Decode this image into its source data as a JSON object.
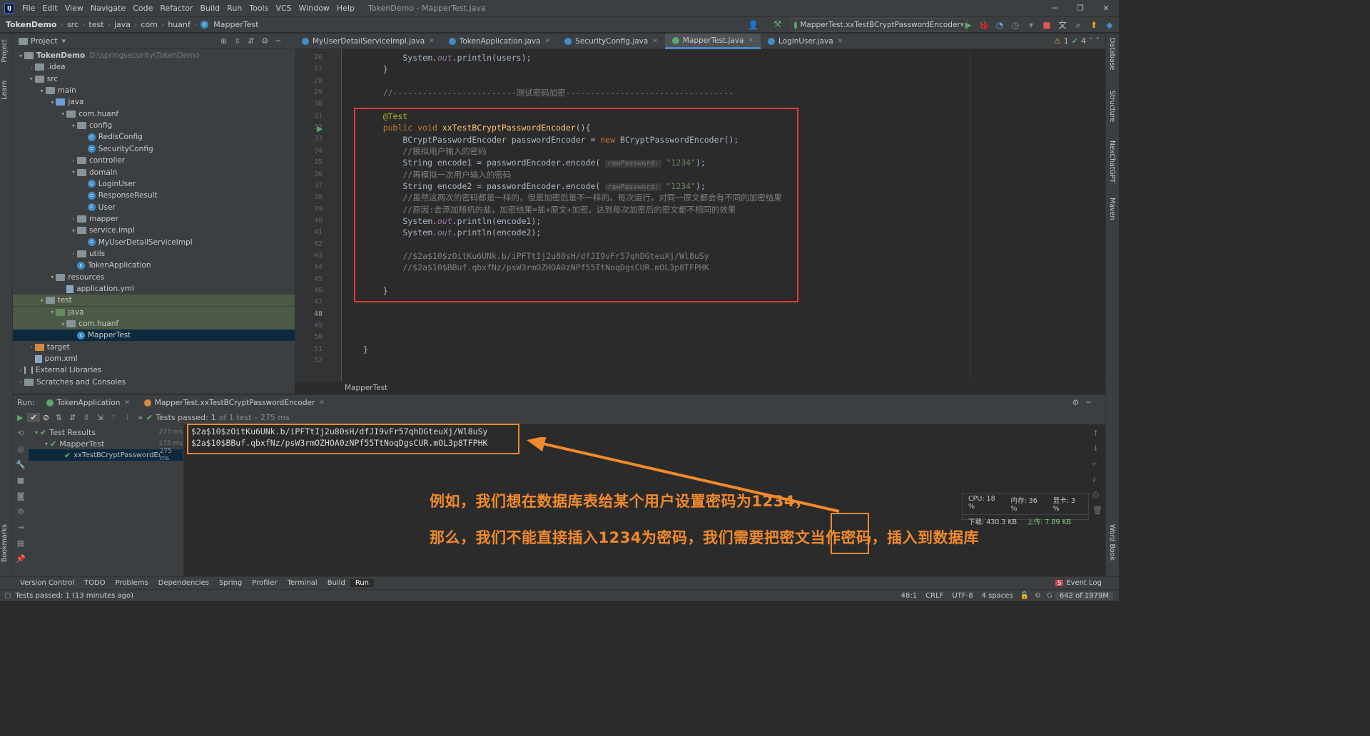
{
  "menu": {
    "items": [
      "File",
      "Edit",
      "View",
      "Navigate",
      "Code",
      "Refactor",
      "Build",
      "Run",
      "Tools",
      "VCS",
      "Window",
      "Help"
    ],
    "title": "TokenDemo - MapperTest.java"
  },
  "breadcrumb": [
    "TokenDemo",
    "src",
    "test",
    "java",
    "com",
    "huanf",
    "MapperTest"
  ],
  "run_config": "MapperTest.xxTestBCryptPasswordEncoder",
  "project_panel": {
    "title": "Project",
    "tree": [
      {
        "label": "TokenDemo",
        "path": "D:\\springsecurity\\TokenDemo",
        "depth": 0,
        "type": "module",
        "open": true
      },
      {
        "label": ".idea",
        "depth": 1,
        "type": "folder",
        "open": false
      },
      {
        "label": "src",
        "depth": 1,
        "type": "folder",
        "open": true
      },
      {
        "label": "main",
        "depth": 2,
        "type": "folder",
        "open": true
      },
      {
        "label": "java",
        "depth": 3,
        "type": "folder-blue",
        "open": true
      },
      {
        "label": "com.huanf",
        "depth": 4,
        "type": "folder",
        "open": true
      },
      {
        "label": "config",
        "depth": 5,
        "type": "folder",
        "open": true
      },
      {
        "label": "RedisConfig",
        "depth": 6,
        "type": "class"
      },
      {
        "label": "SecurityConfig",
        "depth": 6,
        "type": "class"
      },
      {
        "label": "controller",
        "depth": 5,
        "type": "folder",
        "open": false
      },
      {
        "label": "domain",
        "depth": 5,
        "type": "folder",
        "open": true
      },
      {
        "label": "LoginUser",
        "depth": 6,
        "type": "class"
      },
      {
        "label": "ResponseResult",
        "depth": 6,
        "type": "class"
      },
      {
        "label": "User",
        "depth": 6,
        "type": "class"
      },
      {
        "label": "mapper",
        "depth": 5,
        "type": "folder",
        "open": false
      },
      {
        "label": "service.impl",
        "depth": 5,
        "type": "folder",
        "open": true
      },
      {
        "label": "MyUserDetailServiceImpl",
        "depth": 6,
        "type": "class"
      },
      {
        "label": "utils",
        "depth": 5,
        "type": "folder",
        "open": false
      },
      {
        "label": "TokenApplication",
        "depth": 5,
        "type": "class"
      },
      {
        "label": "resources",
        "depth": 3,
        "type": "folder",
        "open": true
      },
      {
        "label": "application.yml",
        "depth": 4,
        "type": "file"
      },
      {
        "label": "test",
        "depth": 2,
        "type": "folder",
        "open": true
      },
      {
        "label": "java",
        "depth": 3,
        "type": "folder-green",
        "open": true
      },
      {
        "label": "com.huanf",
        "depth": 4,
        "type": "folder",
        "open": true
      },
      {
        "label": "MapperTest",
        "depth": 5,
        "type": "class",
        "selected": true
      },
      {
        "label": "target",
        "depth": 1,
        "type": "folder-orange",
        "open": false
      },
      {
        "label": "pom.xml",
        "depth": 1,
        "type": "file"
      },
      {
        "label": "External Libraries",
        "depth": 0,
        "type": "lib",
        "open": false
      },
      {
        "label": "Scratches and Consoles",
        "depth": 0,
        "type": "scratch",
        "open": false
      }
    ]
  },
  "editor_tabs": [
    "MyUserDetailServiceImpl.java",
    "TokenApplication.java",
    "SecurityConfig.java",
    "MapperTest.java",
    "LoginUser.java"
  ],
  "editor_active_tab": 3,
  "inspection": {
    "warnings": "1",
    "ok": "4"
  },
  "editor_footer": "MapperTest",
  "code": {
    "line_numbers": [
      "26",
      "27",
      "28",
      "29",
      "30",
      "31",
      "32",
      "33",
      "34",
      "35",
      "36",
      "37",
      "38",
      "39",
      "40",
      "41",
      "42",
      "43",
      "44",
      "45",
      "46",
      "47",
      "48",
      "49",
      "50",
      "51",
      "52"
    ],
    "l26_a": "        System.",
    "l26_b": "out",
    "l26_c": ".println(users);",
    "l27": "    }",
    "l29": "    //-------------------------测试密码加密----------------------------------",
    "l31": "    @Test",
    "l32_kw": "    public void ",
    "l32_fn": "xxTestBCryptPasswordEncoder",
    "l32_rest": "(){",
    "l33_a": "        BCryptPasswordEncoder passwordEncoder = ",
    "l33_kw": "new ",
    "l33_b": "BCryptPasswordEncoder();",
    "l34": "        //模拟用户输入的密码",
    "l35_a": "        String encode1 = passwordEncoder.encode( ",
    "l35_hint": "rawPassword:",
    "l35_str": " \"1234\"",
    "l35_b": ");",
    "l36": "        //再模拟一次用户输入的密码",
    "l37_a": "        String encode2 = passwordEncoder.encode( ",
    "l37_hint": "rawPassword:",
    "l37_str": " \"1234\"",
    "l37_b": ");",
    "l38": "        //虽然这两次的密码都是一样的，但是加密后是不一样的。每次运行，对同一原文都会有不同的加密结果",
    "l39": "        //原因:会添加随机的盐，加密结果=盐+原文+加密。达到每次加密后的密文都不相同的效果",
    "l40_a": "        System.",
    "l40_b": "out",
    "l40_c": ".println(encode1);",
    "l41_a": "        System.",
    "l41_b": "out",
    "l41_c": ".println(encode2);",
    "l43": "        //$2a$10$zOitKu6UNk.b/iPFTtIj2u80sH/dfJI9vFr57qhDGteuXj/Wl8uSy",
    "l44": "        //$2a$10$BBuf.qbxfNz/psW3rmOZHOA0zNPf55TtNoqDgsCUR.mOL3p8TFPHK",
    "l46": "    }",
    "l51": "}"
  },
  "run_panel": {
    "label": "Run:",
    "tabs": [
      "TokenApplication",
      "MapperTest.xxTestBCryptPasswordEncoder"
    ],
    "status_passed": "Tests passed:",
    "status_count": "1",
    "status_rest": "of 1 test – 275 ms",
    "tree": [
      {
        "label": "Test Results",
        "time": "275 ms"
      },
      {
        "label": "MapperTest",
        "time": "275 ms"
      },
      {
        "label": "xxTestBCryptPasswordEn",
        "time": "275 ms"
      }
    ],
    "output": [
      "$2a$10$zOitKu6UNk.b/iPFTtIj2u80sH/dfJI9vFr57qhDGteuXj/Wl8uSy",
      "$2a$10$BBuf.qbxfNz/psW3rmOZHOA0zNPf55TtNoqDgsCUR.mOL3p8TFPHK"
    ]
  },
  "annotation": {
    "line1": "例如，我们想在数据库表给某个用户设置密码为1234，",
    "line2": "那么，我们不能直接插入1234为密码，我们需要把密文当作密码，插入到数据库",
    "color": "#f08a2c"
  },
  "sysmon": {
    "cpu": "CPU: 18 %",
    "mem": "内存: 36 %",
    "gpu": "显卡: 3 %",
    "down": "下载: 430.3 KB",
    "up": "上传: 7.89 KB"
  },
  "tool_windows": [
    "Version Control",
    "TODO",
    "Problems",
    "Dependencies",
    "Spring",
    "Profiler",
    "Terminal",
    "Build",
    "Run"
  ],
  "event_log": "Event Log",
  "status": {
    "message": "Tests passed: 1 (13 minutes ago)",
    "position": "48:1",
    "line_sep": "CRLF",
    "encoding": "UTF-8",
    "indent": "4 spaces",
    "memory": "642 of 1979M"
  },
  "side_tabs_left": [
    "Project",
    "Learn",
    "Bookmarks"
  ],
  "side_tabs_right": [
    "Database",
    "Structure",
    "NexChatGPT",
    "Maven",
    "Word Book"
  ]
}
